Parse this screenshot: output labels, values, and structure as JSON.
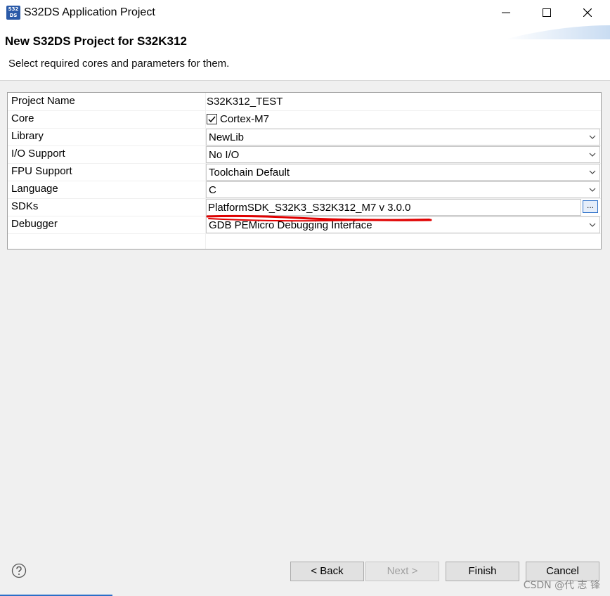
{
  "window": {
    "title": "S32DS Application Project",
    "icon_text": "S32 DS"
  },
  "header": {
    "title": "New S32DS Project for S32K312",
    "description": "Select required cores and parameters for them."
  },
  "table": {
    "rows": [
      {
        "label": "Project Name",
        "value": "S32K312_TEST"
      },
      {
        "label": "Core",
        "value": "Cortex-M7",
        "checked": true
      },
      {
        "label": "Library",
        "value": "NewLib"
      },
      {
        "label": "I/O Support",
        "value": "No I/O"
      },
      {
        "label": "FPU Support",
        "value": "Toolchain Default"
      },
      {
        "label": "Language",
        "value": "C"
      },
      {
        "label": "SDKs",
        "value": "PlatformSDK_S32K3_S32K312_M7 v 3.0.0",
        "browse_label": "..."
      },
      {
        "label": "Debugger",
        "value": "GDB PEMicro Debugging Interface"
      }
    ]
  },
  "buttons": {
    "back": "< Back",
    "next": "Next >",
    "finish": "Finish",
    "cancel": "Cancel"
  },
  "watermark": "CSDN @代 志 锋",
  "colors": {
    "accent": "#2b6fc8",
    "annotation": "#e00000"
  }
}
